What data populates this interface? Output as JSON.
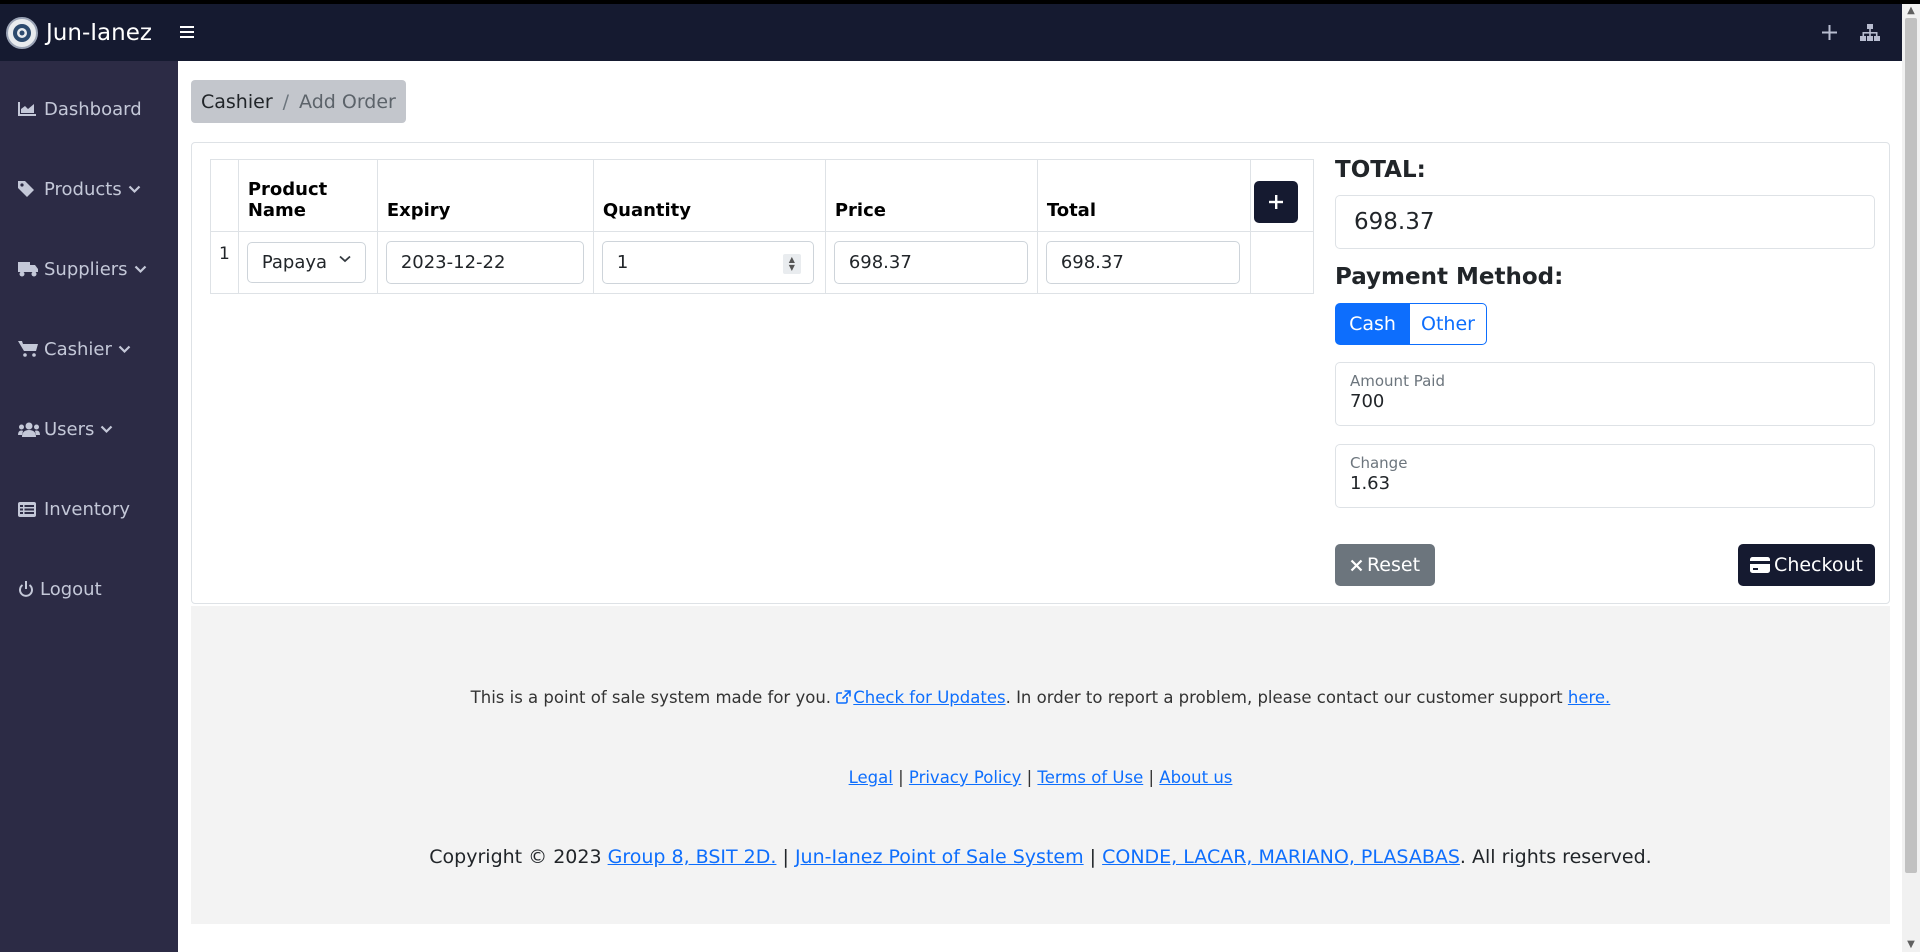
{
  "brand": {
    "name": "Jun-Ianez"
  },
  "sidebar": {
    "items": [
      {
        "label": "Dashboard",
        "icon": "chart-area-icon",
        "has_dropdown": false
      },
      {
        "label": "Products",
        "icon": "tags-icon",
        "has_dropdown": true
      },
      {
        "label": "Suppliers",
        "icon": "truck-icon",
        "has_dropdown": true
      },
      {
        "label": "Cashier",
        "icon": "cart-icon",
        "has_dropdown": true
      },
      {
        "label": "Users",
        "icon": "users-icon",
        "has_dropdown": true
      },
      {
        "label": "Inventory",
        "icon": "list-icon",
        "has_dropdown": false
      },
      {
        "label": "Logout",
        "icon": "power-icon",
        "has_dropdown": false
      }
    ]
  },
  "breadcrumb": {
    "parent": "Cashier",
    "separator": "/",
    "current": "Add Order"
  },
  "order_table": {
    "headers": {
      "product_name": "Product Name",
      "expiry": "Expiry",
      "quantity": "Quantity",
      "price": "Price",
      "total": "Total"
    },
    "rows": [
      {
        "index": "1",
        "product_name": "Papaya",
        "expiry": "2023-12-22",
        "quantity": "1",
        "price": "698.37",
        "total": "698.37"
      }
    ]
  },
  "summary": {
    "total_label": "TOTAL:",
    "total_value": "698.37",
    "payment_label": "Payment Method:",
    "payment_options": [
      "Cash",
      "Other"
    ],
    "payment_selected": "Cash",
    "amount_paid_label": "Amount Paid",
    "amount_paid_value": "700",
    "change_label": "Change",
    "change_value": "1.63",
    "reset_label": "Reset",
    "checkout_label": "Checkout"
  },
  "footer": {
    "line1_prefix": "This is a point of sale system made for you.",
    "updates_link": "Check for Updates",
    "line1_middle": ". In order to report a problem, please contact our customer support",
    "here_link": "here.",
    "legal_links": [
      "Legal",
      "Privacy Policy",
      "Terms of Use",
      "About us"
    ],
    "link_separator": "|",
    "copyright_prefix": "Copyright © 2023",
    "group_link": "Group 8, BSIT 2D.",
    "system_link": "Jun-Ianez Point of Sale System",
    "authors_link": "CONDE, LACAR, MARIANO, PLASABAS",
    "copyright_suffix": ". All rights reserved."
  },
  "colors": {
    "navbar": "#151a30",
    "sidebar": "#2c2b45",
    "primary": "#0d6efd",
    "secondary": "#6c757d",
    "footer_bg": "#f3f3f3"
  }
}
